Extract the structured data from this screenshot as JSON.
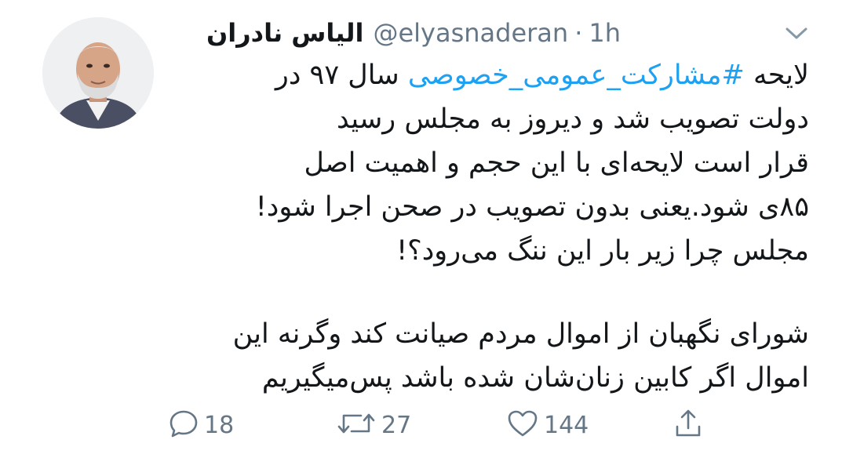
{
  "tweet": {
    "display_name": "الیاس نادران",
    "handle": "@elyasnaderan",
    "separator": "·",
    "time": "1h",
    "lines": [
      {
        "before": "لایحه ",
        "hashtag": "#مشارکت_عمومی_خصوصی",
        "after": " سال ۹۷ در"
      },
      {
        "text": "دولت تصویب شد و دیروز به مجلس رسید"
      },
      {
        "text": "قرار است لایحه‌ای با این حجم و اهمیت اصل"
      },
      {
        "text": "۸۵ی شود.یعنی بدون تصویب در صحن اجرا شود!"
      },
      {
        "text": "مجلس چرا زیر بار این ننگ می‌رود؟!"
      },
      {
        "text": "شورای نگهبان از اموال مردم صیانت کند وگرنه این"
      },
      {
        "text": "اموال اگر کابین زنان‌شان شده باشد پس‌میگیریم"
      }
    ]
  },
  "actions": {
    "reply": {
      "icon": "reply-icon",
      "count": "18"
    },
    "retweet": {
      "icon": "retweet-icon",
      "count": "27"
    },
    "like": {
      "icon": "heart-icon",
      "count": "144"
    },
    "share": {
      "icon": "share-icon"
    }
  },
  "colors": {
    "text": "#14171a",
    "secondary": "#657786",
    "link": "#1da1f2"
  }
}
